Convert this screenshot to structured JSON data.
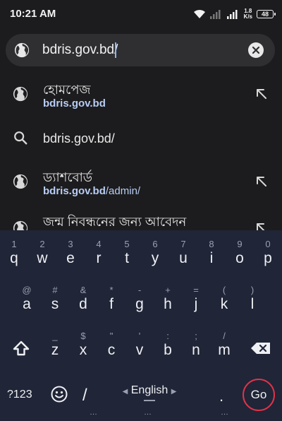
{
  "status_bar": {
    "time": "10:21 AM",
    "net_speed_value": "1.8",
    "net_speed_unit": "K/s",
    "battery": "48"
  },
  "url_bar": {
    "value": "bdris.gov.bd/",
    "icon": "globe-icon",
    "clear_icon": "clear-icon"
  },
  "suggestions": [
    {
      "icon": "globe-icon",
      "title": "হোমপেজ",
      "url_bold": "bdris.gov.bd",
      "url_rest": ""
    },
    {
      "icon": "search-icon",
      "title": "bdris.gov.bd/"
    },
    {
      "icon": "globe-icon",
      "title": "ড্যাশবোর্ড",
      "url_bold": "bdris.gov.bd",
      "url_rest": "/admin/"
    },
    {
      "icon": "globe-icon",
      "title": "জন্ম নিবন্ধনের জন্য আবেদন"
    }
  ],
  "keyboard": {
    "row1": [
      {
        "hint": "1",
        "key": "q"
      },
      {
        "hint": "2",
        "key": "w"
      },
      {
        "hint": "3",
        "key": "e"
      },
      {
        "hint": "4",
        "key": "r"
      },
      {
        "hint": "5",
        "key": "t"
      },
      {
        "hint": "6",
        "key": "y"
      },
      {
        "hint": "7",
        "key": "u"
      },
      {
        "hint": "8",
        "key": "i"
      },
      {
        "hint": "9",
        "key": "o"
      },
      {
        "hint": "0",
        "key": "p"
      }
    ],
    "row2": [
      {
        "hint": "@",
        "key": "a"
      },
      {
        "hint": "#",
        "key": "s"
      },
      {
        "hint": "&",
        "key": "d"
      },
      {
        "hint": "*",
        "key": "f"
      },
      {
        "hint": "-",
        "key": "g"
      },
      {
        "hint": "+",
        "key": "h"
      },
      {
        "hint": "=",
        "key": "j"
      },
      {
        "hint": "(",
        "key": "k"
      },
      {
        "hint": ")",
        "key": "l"
      }
    ],
    "row3": [
      {
        "hint": "_",
        "key": "z"
      },
      {
        "hint": "$",
        "key": "x"
      },
      {
        "hint": "\"",
        "key": "c"
      },
      {
        "hint": "'",
        "key": "v"
      },
      {
        "hint": ":",
        "key": "b"
      },
      {
        "hint": ";",
        "key": "n"
      },
      {
        "hint": "/",
        "key": "m"
      }
    ],
    "symbols_key": "?123",
    "slash_key": "/",
    "language": "English",
    "period_key": ".",
    "go_key": "Go",
    "emoji_icon": "emoji-icon",
    "shift_icon": "shift-icon",
    "backspace_icon": "backspace-icon"
  },
  "colors": {
    "background": "#1c1c1e",
    "url_bar": "#2f2f32",
    "link": "#b8cdf5",
    "keyboard": "#202537",
    "go_ring": "#e0334a"
  }
}
